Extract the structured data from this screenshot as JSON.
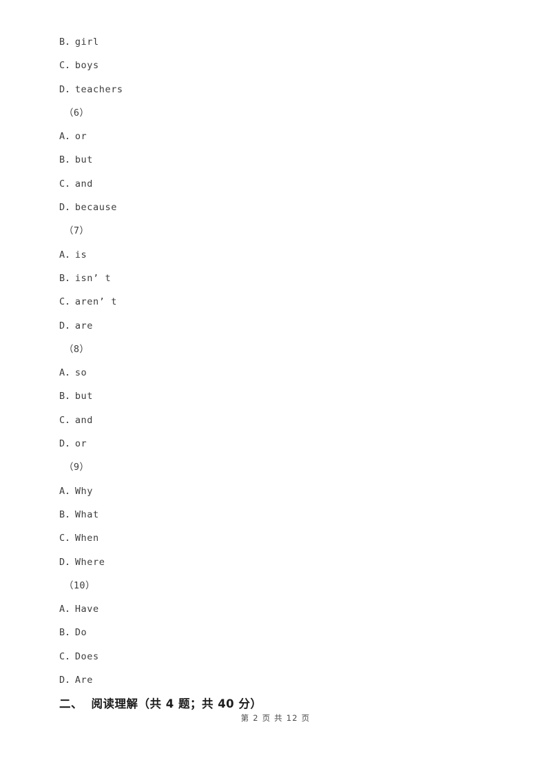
{
  "document": {
    "page_number_label": "第 2 页 共 12 页",
    "section_heading": "二、  阅读理解（共 4 题；共 40 分）"
  },
  "blocks": [
    {
      "type": "option",
      "label": "B．girl"
    },
    {
      "type": "option",
      "label": "C．boys"
    },
    {
      "type": "option",
      "label": "D．teachers"
    },
    {
      "type": "question",
      "label": "（6）"
    },
    {
      "type": "option",
      "label": "A．or"
    },
    {
      "type": "option",
      "label": "B．but"
    },
    {
      "type": "option",
      "label": "C．and"
    },
    {
      "type": "option",
      "label": "D．because"
    },
    {
      "type": "question",
      "label": "（7）"
    },
    {
      "type": "option",
      "label": "A．is"
    },
    {
      "type": "option",
      "label": "B．isn’ t"
    },
    {
      "type": "option",
      "label": "C．aren’ t"
    },
    {
      "type": "option",
      "label": "D．are"
    },
    {
      "type": "question",
      "label": "（8）"
    },
    {
      "type": "option",
      "label": "A．so"
    },
    {
      "type": "option",
      "label": "B．but"
    },
    {
      "type": "option",
      "label": "C．and"
    },
    {
      "type": "option",
      "label": "D．or"
    },
    {
      "type": "question",
      "label": "（9）"
    },
    {
      "type": "option",
      "label": "A．Why"
    },
    {
      "type": "option",
      "label": "B．What"
    },
    {
      "type": "option",
      "label": "C．When"
    },
    {
      "type": "option",
      "label": "D．Where"
    },
    {
      "type": "question",
      "label": "（10）"
    },
    {
      "type": "option",
      "label": "A．Have"
    },
    {
      "type": "option",
      "label": "B．Do"
    },
    {
      "type": "option",
      "label": "C．Does"
    },
    {
      "type": "option",
      "label": "D．Are"
    }
  ]
}
